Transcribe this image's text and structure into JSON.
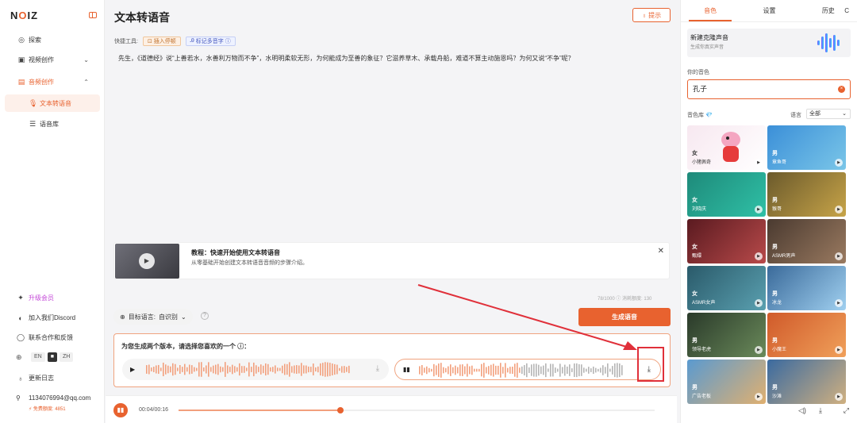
{
  "app": {
    "logo_left": "N",
    "logo_o": "O",
    "logo_right": "IZ"
  },
  "sidebar": {
    "items": [
      {
        "label": "探索",
        "icon": "compass-icon"
      },
      {
        "label": "视频创作",
        "icon": "video-icon",
        "chevron": "⌄"
      },
      {
        "label": "音频创作",
        "icon": "audio-icon",
        "chevron": "⌃"
      },
      {
        "label": "文本转语音",
        "icon": "mic-icon"
      },
      {
        "label": "语音库",
        "icon": "list-icon"
      }
    ],
    "upgrade": "升级会员",
    "discord": "加入我们Discord",
    "contact": "联系合作和反馈",
    "lang_options": [
      "EN",
      "ZH"
    ],
    "changelog": "更新日志",
    "user_email": "1134076994@qq.com",
    "credits": "免费额度: 4851"
  },
  "main": {
    "title": "文本转语音",
    "hint_button": "提示",
    "tools_label": "快捷工具:",
    "tool_insert_pause": "插入停顿",
    "tool_mark_polyphone": "标记多音字",
    "text": "先生，《道德经》说“上善若水，水善利万物而不争”，水明明柔软无形，为何能成为至善的象征？它滋养草木、承载舟船，难道不算主动施恩吗？为何又说“不争”呢？",
    "tutorial_title": "教程：快速开始使用文本转语音",
    "tutorial_desc": "从零基础开始创建文本转语音音频的步骤介绍。",
    "counter": "78/1000 ⓘ  消耗额度: 130",
    "target_lang_label": "目标语言:",
    "target_lang_value": "自识别",
    "generate_button": "生成语音",
    "versions_title": "为您生成两个版本，请选择您喜欢的一个 ⓘ：",
    "playback_time": "00:04/00:16",
    "playback_progress": 0.34,
    "version1_progress": 0.0,
    "version2_progress": 0.5
  },
  "right": {
    "tabs": [
      "音色",
      "设置",
      "历史"
    ],
    "active_tab": "音色",
    "clone_title": "新建克隆声音",
    "clone_sub": "生成你真实声音",
    "your_voice_label": "你的音色",
    "your_voice_value": "孔子",
    "library_label": "音色库 💎",
    "language_label": "语言",
    "language_value": "全部",
    "voices": [
      {
        "gender": "女",
        "name": "小猪佩奇"
      },
      {
        "gender": "男",
        "name": "章鱼哥"
      },
      {
        "gender": "女",
        "name": "刘晓庆"
      },
      {
        "gender": "男",
        "name": "猴哥"
      },
      {
        "gender": "女",
        "name": "甄嬛"
      },
      {
        "gender": "男",
        "name": "ASMR男声"
      },
      {
        "gender": "女",
        "name": "ASMR女声"
      },
      {
        "gender": "男",
        "name": "冰龙"
      },
      {
        "gender": "男",
        "name": "领导老虎"
      },
      {
        "gender": "男",
        "name": "小魔王"
      },
      {
        "gender": "男",
        "name": "广告老板"
      },
      {
        "gender": "男",
        "name": "沙滩"
      }
    ]
  }
}
